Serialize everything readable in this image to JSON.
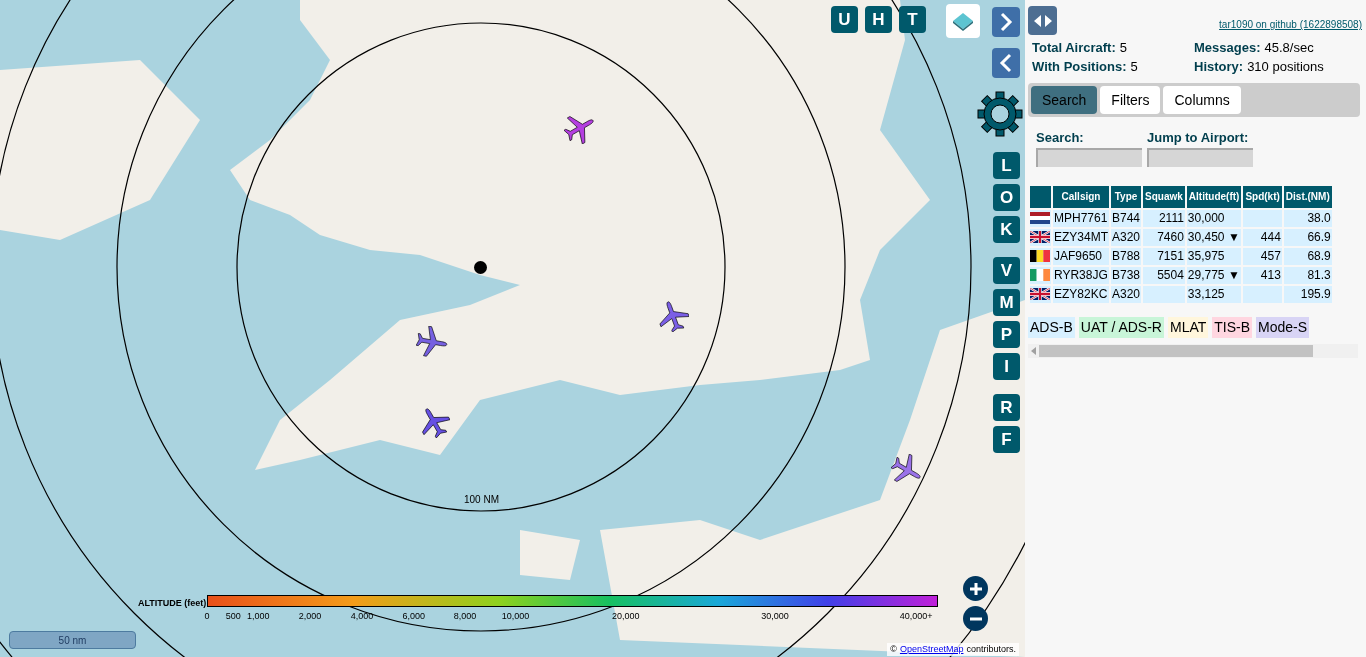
{
  "map": {
    "range_label": "100 NM",
    "scale": "50 nm",
    "attribution_prefix": "©",
    "attribution_link": "OpenStreetMap",
    "attribution_suffix": "contributors.",
    "aircraft": [
      {
        "color": "#b43fe0"
      },
      {
        "color": "#7b5fe6"
      },
      {
        "color": "#7660e0"
      },
      {
        "color": "#6650e3"
      },
      {
        "color": "#9a72e8"
      }
    ],
    "top_buttons": [
      "U",
      "H",
      "T"
    ],
    "side_buttons": [
      "L",
      "O",
      "K",
      "V",
      "M",
      "P",
      "I",
      "R",
      "F"
    ],
    "legend": {
      "title": "ALTITUDE (feet)",
      "ticks": [
        "0",
        "500",
        "1,000",
        "2,000",
        "4,000",
        "6,000",
        "8,000",
        "10,000",
        "20,000",
        "30,000",
        "40,000+"
      ]
    }
  },
  "panel": {
    "github_link": "tar1090 on github (1622898508)",
    "stats": [
      {
        "label": "Total Aircraft:",
        "value": "5"
      },
      {
        "label": "Messages:",
        "value": "45.8/sec"
      },
      {
        "label": "With Positions:",
        "value": "5"
      },
      {
        "label": "History:",
        "value": "310 positions"
      }
    ],
    "tabs": [
      {
        "label": "Search",
        "selected": true
      },
      {
        "label": "Filters",
        "selected": false
      },
      {
        "label": "Columns",
        "selected": false
      }
    ],
    "fields": [
      {
        "label": "Search:"
      },
      {
        "label": "Jump to Airport:"
      }
    ],
    "table": {
      "columns": [
        "Callsign",
        "Type",
        "Squawk",
        "Altitude(ft)",
        "Spd(kt)",
        "Dist.(NM)"
      ],
      "rows": [
        {
          "kind": "nl",
          "cells": [
            "MPH7761",
            "B744",
            "2111",
            "30,000",
            "",
            "38.0"
          ]
        },
        {
          "kind": "gb",
          "cells": [
            "EZY34MT",
            "A320",
            "7460",
            "30,450 ▼",
            "444",
            "66.9"
          ]
        },
        {
          "kind": "be",
          "cells": [
            "JAF9650",
            "B788",
            "7151",
            "35,975",
            "457",
            "68.9"
          ]
        },
        {
          "kind": "ie",
          "cells": [
            "RYR38JG",
            "B738",
            "5504",
            "29,775 ▼",
            "413",
            "81.3"
          ]
        },
        {
          "kind": "gb",
          "cells": [
            "EZY82KC",
            "A320",
            "",
            "33,125",
            "",
            "195.9"
          ]
        }
      ]
    },
    "sources": [
      {
        "label": "ADS-B",
        "color": "#d7f0ff"
      },
      {
        "label": "UAT / ADS-R",
        "color": "#c8f5d8"
      },
      {
        "label": "MLAT",
        "color": "#fff6dc"
      },
      {
        "label": "TIS-B",
        "color": "#ffd6e0"
      },
      {
        "label": "Mode-S",
        "color": "#d8d4f5"
      }
    ]
  }
}
